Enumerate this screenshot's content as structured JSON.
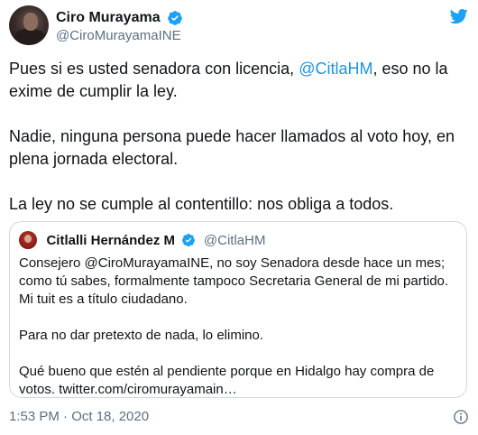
{
  "author": {
    "display_name": "Ciro Murayama",
    "handle": "@CiroMurayamaINE",
    "verified": true
  },
  "tweet": {
    "paragraph_1_before": "Pues si es usted senadora con licencia, ",
    "paragraph_1_mention": "@CitlaHM",
    "paragraph_1_after": ", eso no la exime de cumplir la ley.",
    "paragraph_2": "Nadie, ninguna persona puede hacer llamados al voto hoy, en plena jornada electoral.",
    "paragraph_3": "La ley no se cumple al contentillo: nos obliga a todos."
  },
  "quoted_tweet": {
    "display_name": "Citlalli Hernández M",
    "handle": "@CitlaHM",
    "verified": true,
    "paragraph_1": "Consejero @CiroMurayamaINE, no soy Senadora desde hace un mes; como tú sabes, formalmente tampoco Secretaria General de mi partido. Mi tuit es a título ciudadano.",
    "paragraph_2": "Para no dar pretexto de nada, lo elimino.",
    "paragraph_3": "Qué bueno que estén al pendiente porque en Hidalgo hay compra de votos. twitter.com/ciromurayamain…"
  },
  "footer": {
    "timestamp": "1:53 PM · Oct 18, 2020"
  },
  "colors": {
    "accent": "#1b95e0",
    "verified": "#1da1f2",
    "secondary_text": "#5b7083",
    "border": "#cfd9de"
  },
  "icons": {
    "brand": "twitter-bird-icon",
    "verified": "verified-badge-icon",
    "info": "info-icon"
  }
}
